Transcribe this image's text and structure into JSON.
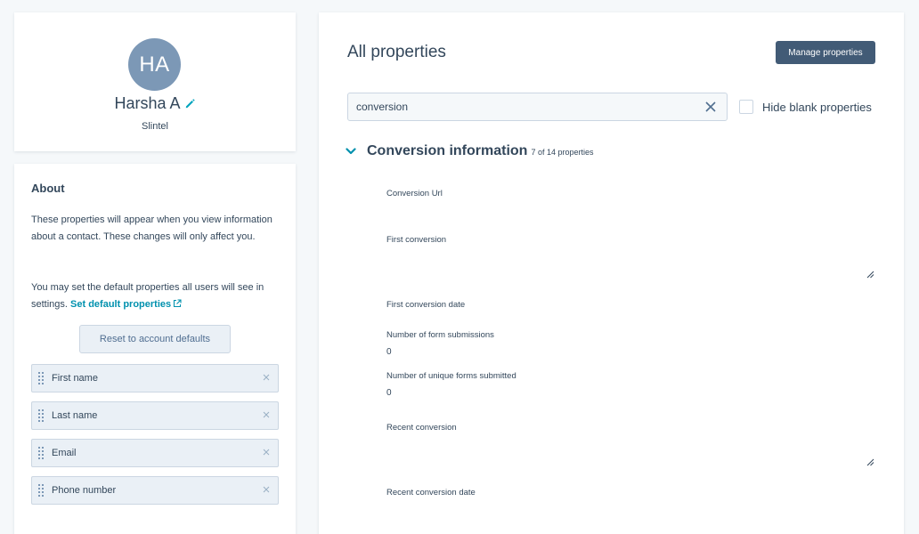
{
  "profile": {
    "initials": "HA",
    "name": "Harsha A",
    "company": "Slintel"
  },
  "about": {
    "title": "About",
    "description": "These properties will appear when you view information about a contact. These changes will only affect you.",
    "default_text": "You may set the default properties all users will see in settings.",
    "default_link": "Set default properties",
    "reset_label": "Reset to account defaults",
    "properties": [
      {
        "label": "First name"
      },
      {
        "label": "Last name"
      },
      {
        "label": "Email"
      },
      {
        "label": "Phone number"
      }
    ]
  },
  "main": {
    "title": "All properties",
    "manage_label": "Manage properties",
    "search_value": "conversion",
    "hide_blank_label": "Hide blank properties",
    "section": {
      "title": "Conversion information",
      "count": "7 of 14 properties",
      "fields": [
        {
          "label": "Conversion Url",
          "value": ""
        },
        {
          "label": "First conversion",
          "value": ""
        },
        {
          "label": "First conversion date",
          "value": ""
        },
        {
          "label": "Number of form submissions",
          "value": "0"
        },
        {
          "label": "Number of unique forms submitted",
          "value": "0"
        },
        {
          "label": "Recent conversion",
          "value": ""
        },
        {
          "label": "Recent conversion date",
          "value": ""
        }
      ]
    }
  },
  "colors": {
    "accent": "#425b76",
    "link": "#0091ae",
    "avatar": "#7c98b6",
    "edit_icon": "#00a4bd"
  }
}
